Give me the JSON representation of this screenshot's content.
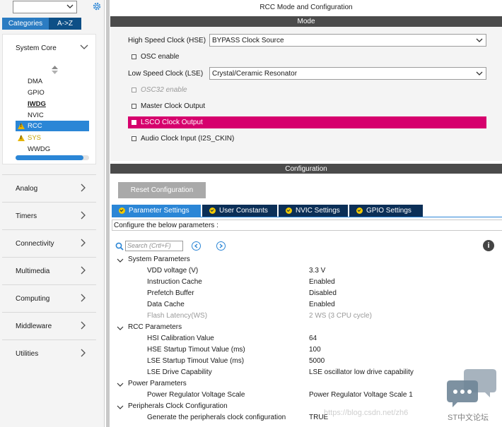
{
  "left": {
    "search": {
      "value": ""
    },
    "tabs": [
      "Categories",
      "A->Z"
    ],
    "system_core": {
      "title": "System Core",
      "items": [
        "DMA",
        "GPIO",
        "IWDG",
        "NVIC",
        "RCC",
        "SYS",
        "WWDG"
      ]
    },
    "categories": [
      "Analog",
      "Timers",
      "Connectivity",
      "Multimedia",
      "Computing",
      "Middleware",
      "Utilities"
    ]
  },
  "header": {
    "title": "RCC Mode and Configuration"
  },
  "mode": {
    "section_title": "Mode",
    "hse_label": "High Speed Clock (HSE)",
    "hse_value": "BYPASS Clock Source",
    "osc_enable": "OSC enable",
    "lse_label": "Low Speed Clock (LSE)",
    "lse_value": "Crystal/Ceramic Resonator",
    "osc32_enable": "OSC32 enable",
    "mco": "Master Clock Output",
    "lsco": "LSCO Clock Output",
    "audio": "Audio Clock Input (I2S_CKIN)"
  },
  "config": {
    "section_title": "Configuration",
    "reset_label": "Reset Configuration",
    "tabs": [
      "Parameter Settings",
      "User Constants",
      "NVIC Settings",
      "GPIO Settings"
    ],
    "description": "Configure the below parameters :",
    "search_placeholder": "Search (Crtl+F)",
    "groups": [
      {
        "name": "System Parameters",
        "params": [
          {
            "name": "VDD voltage (V)",
            "value": "3.3 V"
          },
          {
            "name": "Instruction Cache",
            "value": "Enabled"
          },
          {
            "name": "Prefetch Buffer",
            "value": "Disabled"
          },
          {
            "name": "Data Cache",
            "value": "Enabled"
          },
          {
            "name": "Flash Latency(WS)",
            "value": "2 WS (3 CPU cycle)"
          }
        ]
      },
      {
        "name": "RCC Parameters",
        "params": [
          {
            "name": "HSI Calibration Value",
            "value": "64"
          },
          {
            "name": "HSE Startup Timout Value (ms)",
            "value": "100"
          },
          {
            "name": "LSE Startup Timout Value (ms)",
            "value": "5000"
          },
          {
            "name": "LSE Drive Capability",
            "value": "LSE oscillator low drive capability"
          }
        ]
      },
      {
        "name": "Power Parameters",
        "params": [
          {
            "name": "Power Regulator Voltage Scale",
            "value": "Power Regulator Voltage Scale 1"
          }
        ]
      },
      {
        "name": "Peripherals Clock Configuration",
        "params": [
          {
            "name": "Generate the peripherals clock configuration",
            "value": "TRUE"
          }
        ]
      }
    ]
  },
  "watermark": {
    "url": "https://blog.csdn.net/zh6",
    "brand": "ST中文论坛"
  }
}
